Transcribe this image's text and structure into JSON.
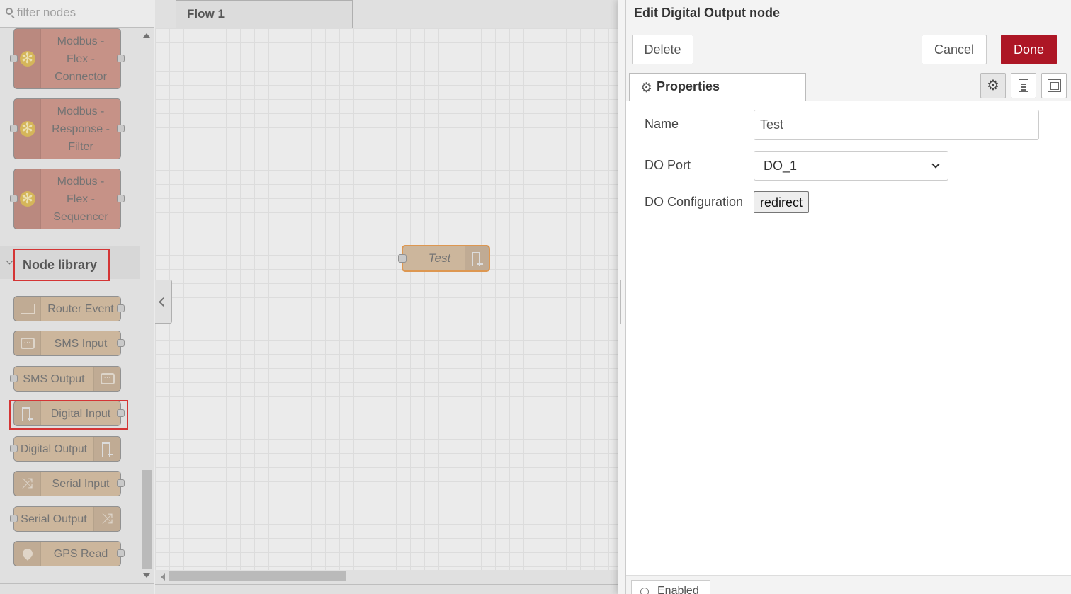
{
  "palette": {
    "search_placeholder": "filter nodes",
    "modbus_nodes": [
      {
        "label": "Modbus - Flex - Connector"
      },
      {
        "label": "Modbus - Response - Filter"
      },
      {
        "label": "Modbus - Flex - Sequencer"
      }
    ],
    "library_title": "Node library",
    "library_nodes": [
      {
        "label": "Router Event",
        "icon": "graph-icon"
      },
      {
        "label": "SMS Input",
        "icon": "chat-icon"
      },
      {
        "label": "SMS Output",
        "icon": "chat-icon"
      },
      {
        "label": "Digital Input",
        "icon": "pulse-icon"
      },
      {
        "label": "Digital Output",
        "icon": "pulse-icon"
      },
      {
        "label": "Serial Input",
        "icon": "shuffle-icon"
      },
      {
        "label": "Serial Output",
        "icon": "shuffle-icon"
      },
      {
        "label": "GPS Read",
        "icon": "map-pin-icon"
      }
    ]
  },
  "workspace": {
    "tab_label": "Flow 1",
    "flow_node_label": "Test"
  },
  "tray": {
    "title": "Edit Digital Output node",
    "delete_label": "Delete",
    "cancel_label": "Cancel",
    "done_label": "Done",
    "properties_tab": "Properties",
    "fields": {
      "name_label": "Name",
      "name_value": "Test",
      "port_label": "DO Port",
      "port_value": "DO_1",
      "config_label": "DO Configuration",
      "config_button": "redirect"
    },
    "enabled_label": "Enabled"
  },
  "colors": {
    "done_button": "#ad1625",
    "modbus_node": "#d59a8e",
    "library_node": "#dcc3a6",
    "highlight": "#e53030",
    "selected_node_border": "#f0a050"
  }
}
